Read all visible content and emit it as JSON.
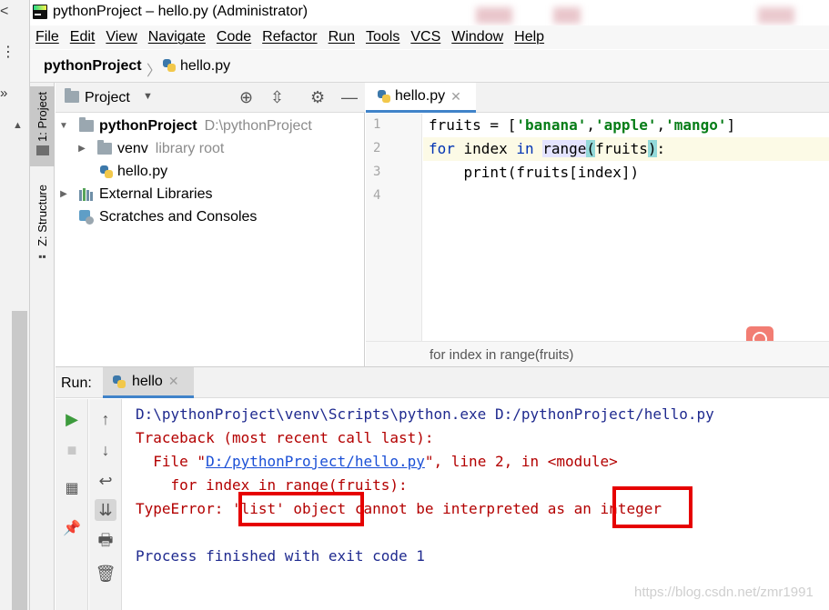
{
  "outer": {
    "chevron": "<",
    "dots": "⋮",
    "double_chevron": "»"
  },
  "window": {
    "title": "pythonProject – hello.py (Administrator)"
  },
  "menu": [
    "File",
    "Edit",
    "View",
    "Navigate",
    "Code",
    "Refactor",
    "Run",
    "Tools",
    "VCS",
    "Window",
    "Help"
  ],
  "breadcrumb": {
    "project": "pythonProject",
    "file": "hello.py"
  },
  "side_tabs": {
    "project": "1: Project",
    "structure": "Z: Structure"
  },
  "project_panel": {
    "title": "Project",
    "tree": [
      {
        "name": "pythonProject",
        "hint": "D:\\pythonProject",
        "kind": "folder",
        "bold": true,
        "expanded": true
      },
      {
        "name": "venv",
        "hint": "library root",
        "kind": "folder",
        "expanded": false
      },
      {
        "name": "hello.py",
        "hint": "",
        "kind": "python"
      },
      {
        "name": "External Libraries",
        "hint": "",
        "kind": "library",
        "expanded": false
      },
      {
        "name": "Scratches and Consoles",
        "hint": "",
        "kind": "scratch"
      }
    ]
  },
  "editor": {
    "tab": "hello.py",
    "line_numbers": [
      "1",
      "2",
      "3",
      "4"
    ],
    "line1": {
      "a": "fruits = [",
      "s1": "'banana'",
      "c1": ",",
      "s2": "'apple'",
      "c2": ",",
      "s3": "'mango'",
      "end": "]"
    },
    "line2": {
      "kw_for": "for",
      "sp1": " index ",
      "kw_in": "in",
      "sp2": " ",
      "range": "range",
      "open": "(",
      "arg": "fruits",
      "close": ")",
      "colon": ":"
    },
    "line3": "    print(fruits[index])",
    "breadcrumb": "for index in range(fruits)"
  },
  "run_panel": {
    "label": "Run:",
    "tab": "hello",
    "console": {
      "cmd": "D:\\pythonProject\\venv\\Scripts\\python.exe D:/pythonProject/hello.py",
      "traceback": "Traceback (most recent call last):",
      "file_prefix": "  File \"",
      "file_link": "D:/pythonProject/hello.py",
      "file_suffix": "\", line 2, in <module>",
      "code": "    for index in range(fruits):",
      "error_prefix": "TypeError: '",
      "error_obj": "list' object",
      "error_mid": " cannot be interpreted as an ",
      "error_type": "integer",
      "exit": "Process finished with exit code 1"
    }
  },
  "watermark": "https://blog.csdn.net/zmr1991",
  "colors": {
    "accent": "#4083c9",
    "error_red": "#b30000",
    "highlight_box": "#e60000",
    "console_blue": "#1f2a8f"
  }
}
